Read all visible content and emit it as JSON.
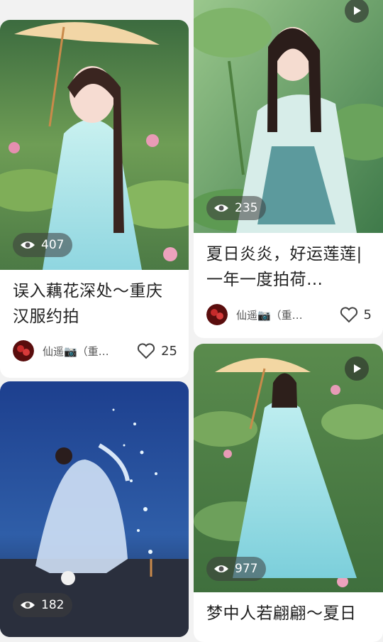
{
  "feed": {
    "cards": [
      {
        "title": "误入藕花深处～重庆汉服约拍",
        "views": "407",
        "author": "仙遥📷（重…",
        "likes": "25",
        "is_video": false
      },
      {
        "title": "夏日炎炎，好运莲莲|一年一度拍荷…",
        "views": "235",
        "author": "仙遥📷（重…",
        "likes": "5",
        "is_video": true
      },
      {
        "title": "",
        "views": "182",
        "author": "",
        "likes": "",
        "is_video": false
      },
      {
        "title": "梦中人若翩翩～夏日",
        "views": "977",
        "author": "",
        "likes": "",
        "is_video": true
      }
    ]
  },
  "colors": {
    "title_text": "#222222",
    "meta_text": "#555555",
    "badge_bg": "rgba(60,60,60,0.55)",
    "page_bg": "#f2f2f2"
  },
  "icons": [
    "eye-icon",
    "heart-outline-icon",
    "play-icon",
    "avatar"
  ]
}
